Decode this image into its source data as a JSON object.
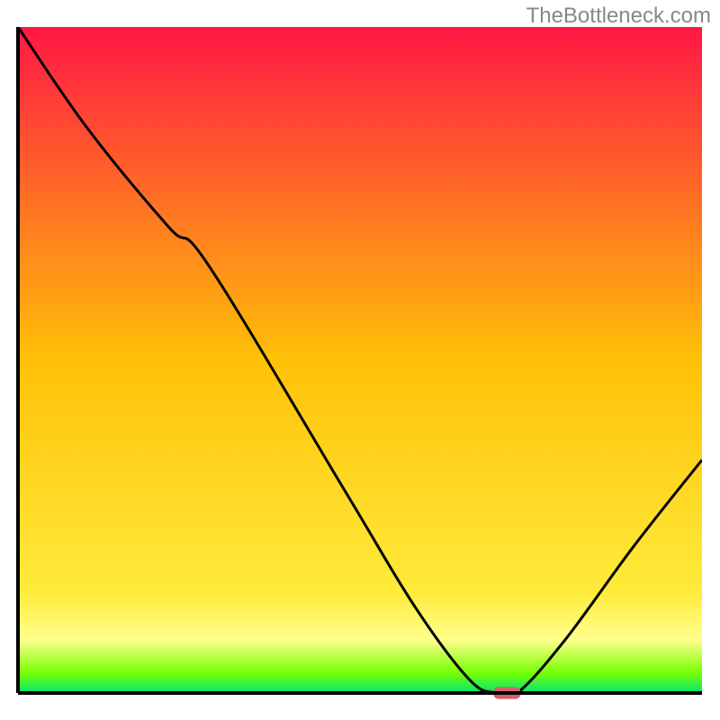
{
  "watermark": "TheBottleneck.com",
  "chart_data": {
    "type": "line",
    "title": "",
    "xlabel": "",
    "ylabel": "",
    "xlim": [
      0,
      100
    ],
    "ylim": [
      0,
      100
    ],
    "background_gradient": {
      "stops": [
        {
          "offset": 0,
          "color": "#ff1744"
        },
        {
          "offset": 50,
          "color": "#ffc107"
        },
        {
          "offset": 85,
          "color": "#ffeb3b"
        },
        {
          "offset": 92,
          "color": "#ffff8d"
        },
        {
          "offset": 97,
          "color": "#76ff03"
        },
        {
          "offset": 100,
          "color": "#00e676"
        }
      ]
    },
    "series": [
      {
        "name": "bottleneck-curve",
        "type": "line",
        "color": "#000000",
        "x": [
          0,
          10,
          22,
          28,
          48,
          58,
          66,
          70,
          73,
          80,
          90,
          100
        ],
        "values": [
          100,
          85,
          70,
          64,
          30,
          13,
          2,
          0,
          0,
          8,
          22,
          35
        ]
      }
    ],
    "marker": {
      "name": "optimal-point",
      "x": 71.5,
      "y": 0,
      "color": "#d35f6a",
      "width": 4,
      "height": 1.8
    },
    "axes_color": "#000000",
    "axes_width": 4
  }
}
